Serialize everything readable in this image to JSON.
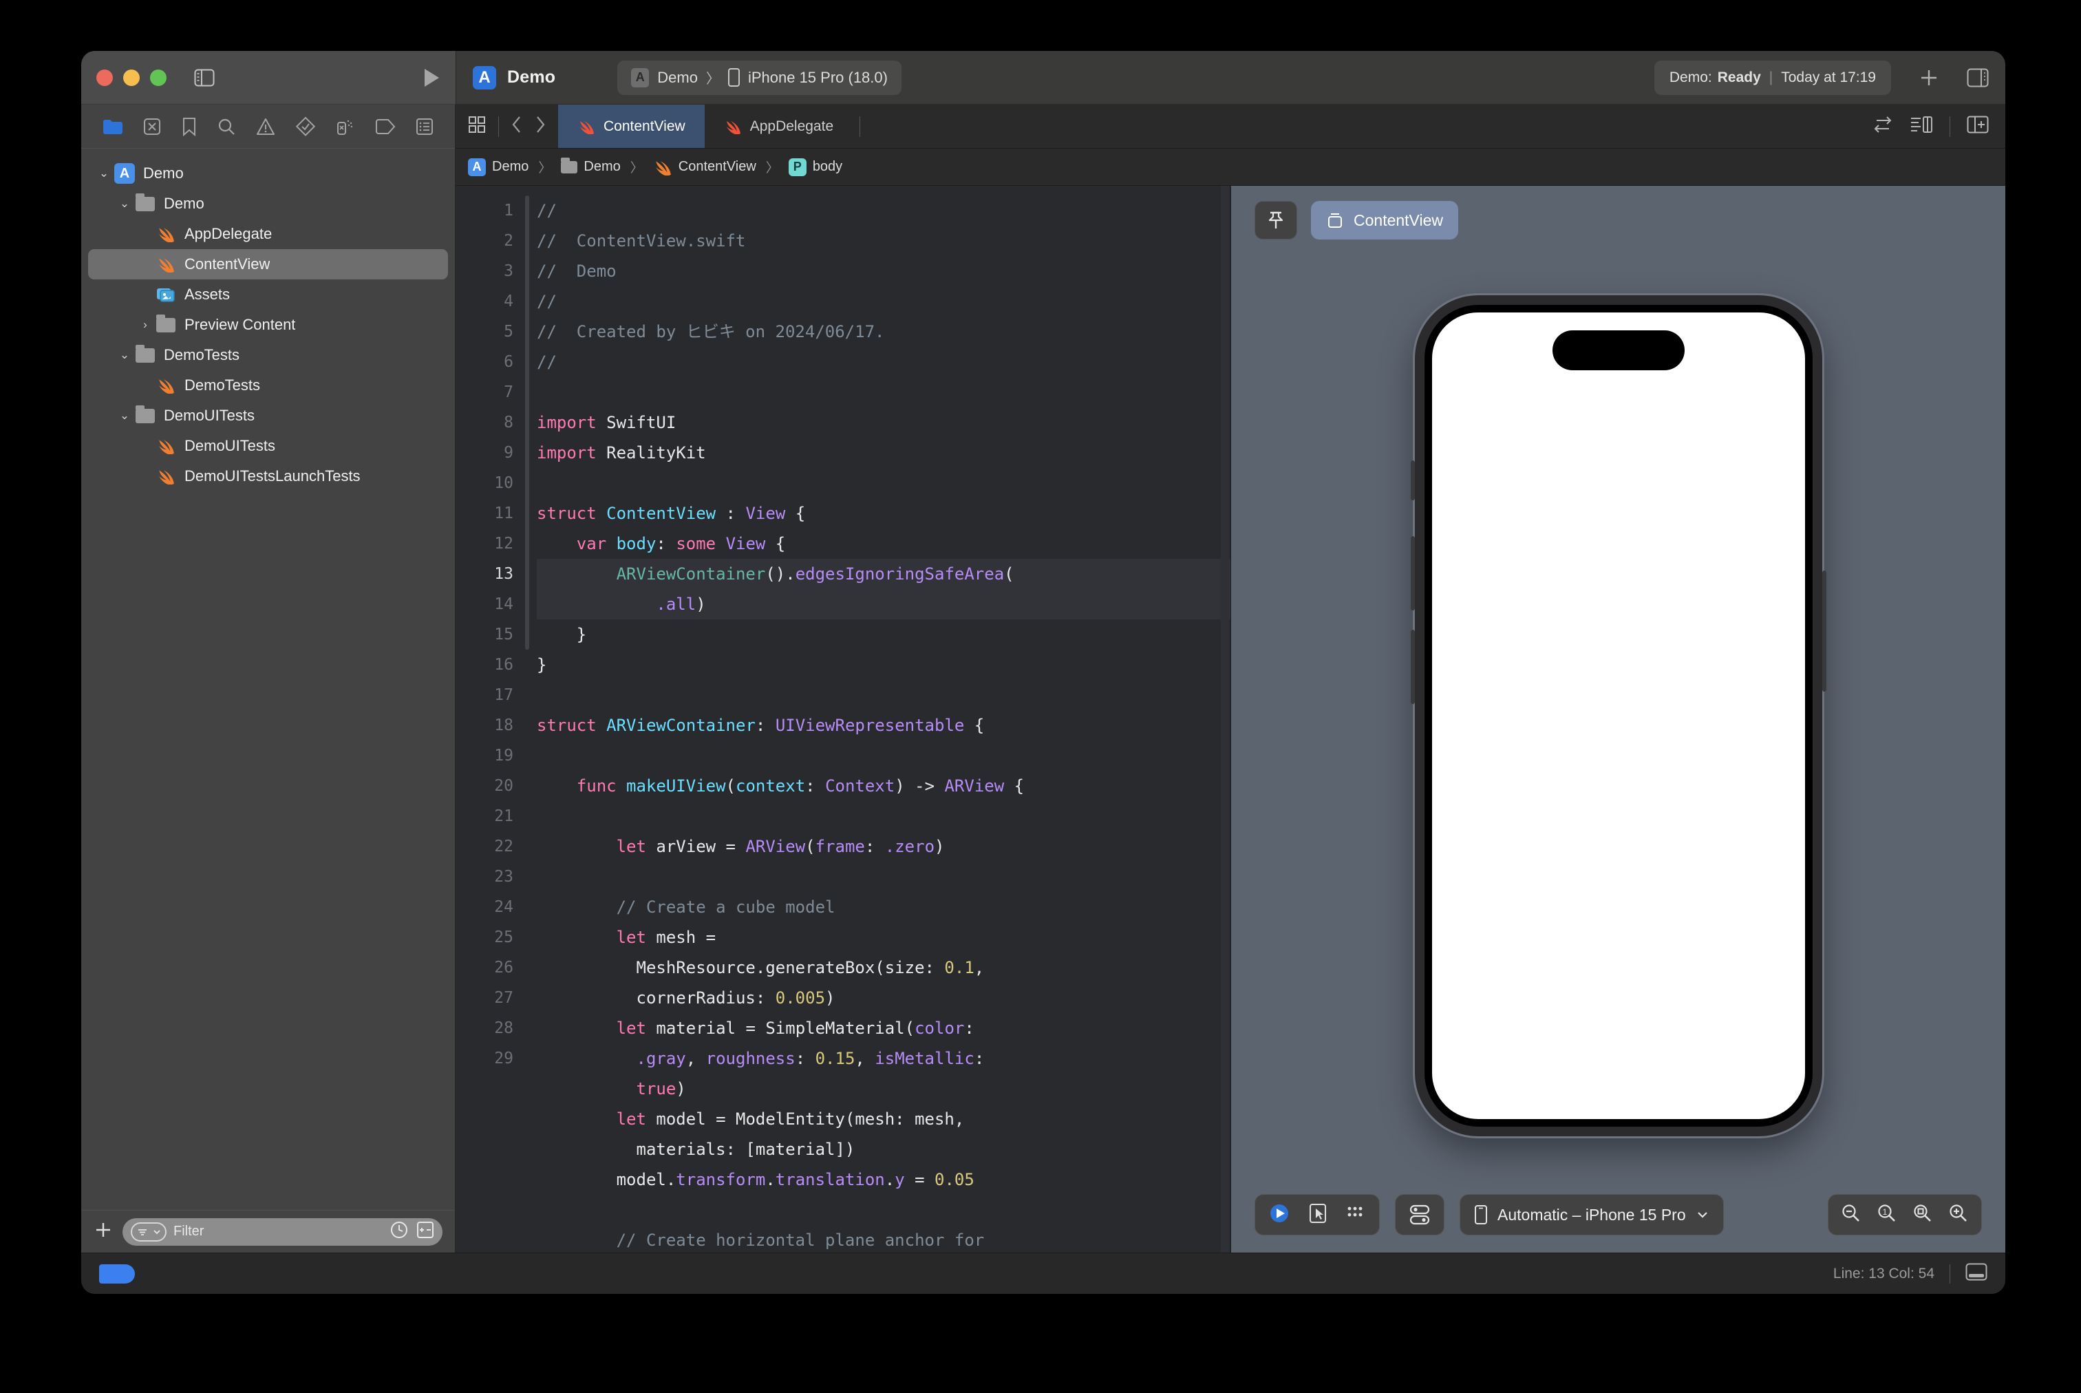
{
  "window": {
    "traffic_lights": [
      "close",
      "minimize",
      "zoom"
    ],
    "sidebar_toggle_icon": "sidebar-icon",
    "run_icon": "run-triangle-icon"
  },
  "toolbar": {
    "app_icon": "xcode-app-icon",
    "project_name": "Demo",
    "scheme": {
      "scheme_name": "Demo",
      "separator": "〉",
      "destination": "iPhone 15 Pro (18.0)",
      "scheme_icon": "app-target-icon",
      "device_icon": "iphone-icon"
    },
    "status": {
      "prefix": "Demo:",
      "state": "Ready",
      "separator": "|",
      "time": "Today at 17:19"
    },
    "add_label": "+",
    "inspector_toggle_icon": "inspector-panel-icon"
  },
  "navigator": {
    "tabs": [
      {
        "name": "project-navigator",
        "icon": "folder-icon",
        "active": true
      },
      {
        "name": "source-control-navigator",
        "icon": "source-control-icon",
        "active": false
      },
      {
        "name": "bookmark-navigator",
        "icon": "bookmark-icon",
        "active": false
      },
      {
        "name": "find-navigator",
        "icon": "search-icon",
        "active": false
      },
      {
        "name": "issue-navigator",
        "icon": "warning-triangle-icon",
        "active": false
      },
      {
        "name": "test-navigator",
        "icon": "diamond-check-icon",
        "active": false
      },
      {
        "name": "debug-navigator",
        "icon": "spray-can-icon",
        "active": false
      },
      {
        "name": "breakpoint-navigator",
        "icon": "tag-icon",
        "active": false
      },
      {
        "name": "report-navigator",
        "icon": "report-list-icon",
        "active": false
      }
    ],
    "tree": [
      {
        "label": "Demo",
        "indent": 0,
        "disclosure": "open",
        "icon": "xcode-project-icon",
        "selected": false
      },
      {
        "label": "Demo",
        "indent": 1,
        "disclosure": "open",
        "icon": "folder-icon",
        "selected": false
      },
      {
        "label": "AppDelegate",
        "indent": 2,
        "disclosure": "none",
        "icon": "swift-icon",
        "selected": false
      },
      {
        "label": "ContentView",
        "indent": 2,
        "disclosure": "none",
        "icon": "swift-icon",
        "selected": true
      },
      {
        "label": "Assets",
        "indent": 2,
        "disclosure": "none",
        "icon": "assets-icon",
        "selected": false
      },
      {
        "label": "Preview Content",
        "indent": 2,
        "disclosure": "closed",
        "icon": "folder-icon",
        "selected": false
      },
      {
        "label": "DemoTests",
        "indent": 1,
        "disclosure": "open",
        "icon": "folder-icon",
        "selected": false
      },
      {
        "label": "DemoTests",
        "indent": 2,
        "disclosure": "none",
        "icon": "swift-icon",
        "selected": false
      },
      {
        "label": "DemoUITests",
        "indent": 1,
        "disclosure": "open",
        "icon": "folder-icon",
        "selected": false
      },
      {
        "label": "DemoUITests",
        "indent": 2,
        "disclosure": "none",
        "icon": "swift-icon",
        "selected": false
      },
      {
        "label": "DemoUITestsLaunchTests",
        "indent": 2,
        "disclosure": "none",
        "icon": "swift-icon",
        "selected": false
      }
    ],
    "filter": {
      "add_label": "+",
      "placeholder": "Filter",
      "filter_dropdown_icon": "filter-dropdown-icon",
      "recent_icon": "clock-icon",
      "add_remove_icon": "plus-minus-icon"
    }
  },
  "editor": {
    "grid_icon": "editor-grid-icon",
    "back_icon": "chevron-left-icon",
    "forward_icon": "chevron-right-icon",
    "tabs": [
      {
        "label": "ContentView",
        "icon": "swift-icon",
        "active": true
      },
      {
        "label": "AppDelegate",
        "icon": "swift-icon",
        "active": false
      }
    ],
    "trailing_icons": [
      "swap-arrows-icon",
      "minimap-icon",
      "add-editor-icon"
    ],
    "breadcrumb": [
      {
        "label": "Demo",
        "icon": "xcode-project-icon"
      },
      {
        "label": "Demo",
        "icon": "folder-icon"
      },
      {
        "label": "ContentView",
        "icon": "swift-icon"
      },
      {
        "label": "body",
        "icon": "property-badge-icon"
      }
    ],
    "breadcrumb_separator": "〉",
    "highlighted_line": 13,
    "code_lines": [
      {
        "n": "1",
        "tokens": [
          {
            "t": "//",
            "c": "cmt"
          }
        ]
      },
      {
        "n": "2",
        "tokens": [
          {
            "t": "//  ContentView.swift",
            "c": "cmt"
          }
        ]
      },
      {
        "n": "3",
        "tokens": [
          {
            "t": "//  Demo",
            "c": "cmt"
          }
        ]
      },
      {
        "n": "4",
        "tokens": [
          {
            "t": "//",
            "c": "cmt"
          }
        ]
      },
      {
        "n": "5",
        "tokens": [
          {
            "t": "//  Created by ヒビキ on 2024/06/17.",
            "c": "cmt"
          }
        ]
      },
      {
        "n": "6",
        "tokens": [
          {
            "t": "//",
            "c": "cmt"
          }
        ]
      },
      {
        "n": "7",
        "tokens": []
      },
      {
        "n": "8",
        "tokens": [
          {
            "t": "import",
            "c": "kw"
          },
          {
            "t": " SwiftUI",
            "c": "plain"
          }
        ]
      },
      {
        "n": "9",
        "tokens": [
          {
            "t": "import",
            "c": "kw"
          },
          {
            "t": " RealityKit",
            "c": "plain"
          }
        ]
      },
      {
        "n": "10",
        "tokens": []
      },
      {
        "n": "11",
        "tokens": [
          {
            "t": "struct",
            "c": "kw"
          },
          {
            "t": " ",
            "c": "plain"
          },
          {
            "t": "ContentView",
            "c": "type"
          },
          {
            "t": " : ",
            "c": "plain"
          },
          {
            "t": "View",
            "c": "ptype"
          },
          {
            "t": " {",
            "c": "plain"
          }
        ]
      },
      {
        "n": "12",
        "tokens": [
          {
            "t": "    ",
            "c": "plain"
          },
          {
            "t": "var",
            "c": "kw"
          },
          {
            "t": " ",
            "c": "plain"
          },
          {
            "t": "body",
            "c": "type"
          },
          {
            "t": ": ",
            "c": "plain"
          },
          {
            "t": "some",
            "c": "kw"
          },
          {
            "t": " ",
            "c": "plain"
          },
          {
            "t": "View",
            "c": "ptype"
          },
          {
            "t": " {",
            "c": "plain"
          }
        ]
      },
      {
        "n": "13",
        "tokens": [
          {
            "t": "        ",
            "c": "plain"
          },
          {
            "t": "ARViewContainer",
            "c": "fn"
          },
          {
            "t": "()",
            "c": "plain"
          },
          {
            "t": ".",
            "c": "plain"
          },
          {
            "t": "edgesIgnoringSafeArea",
            "c": "ptype"
          },
          {
            "t": "(",
            "c": "plain"
          }
        ]
      },
      {
        "n": "",
        "tokens": [
          {
            "t": "            ",
            "c": "plain"
          },
          {
            "t": ".all",
            "c": "ptype"
          },
          {
            "t": ")",
            "c": "plain"
          }
        ]
      },
      {
        "n": "14",
        "tokens": [
          {
            "t": "    }",
            "c": "plain"
          }
        ]
      },
      {
        "n": "15",
        "tokens": [
          {
            "t": "}",
            "c": "plain"
          }
        ]
      },
      {
        "n": "16",
        "tokens": []
      },
      {
        "n": "17",
        "tokens": [
          {
            "t": "struct",
            "c": "kw"
          },
          {
            "t": " ",
            "c": "plain"
          },
          {
            "t": "ARViewContainer",
            "c": "type"
          },
          {
            "t": ": ",
            "c": "plain"
          },
          {
            "t": "UIViewRepresentable",
            "c": "ptype"
          },
          {
            "t": " {",
            "c": "plain"
          }
        ]
      },
      {
        "n": "18",
        "tokens": []
      },
      {
        "n": "19",
        "tokens": [
          {
            "t": "    ",
            "c": "plain"
          },
          {
            "t": "func",
            "c": "kw"
          },
          {
            "t": " ",
            "c": "plain"
          },
          {
            "t": "makeUIView",
            "c": "type"
          },
          {
            "t": "(",
            "c": "plain"
          },
          {
            "t": "context",
            "c": "type"
          },
          {
            "t": ": ",
            "c": "plain"
          },
          {
            "t": "Context",
            "c": "ptype"
          },
          {
            "t": ") -> ",
            "c": "plain"
          },
          {
            "t": "ARView",
            "c": "ptype"
          },
          {
            "t": " {",
            "c": "plain"
          }
        ]
      },
      {
        "n": "20",
        "tokens": []
      },
      {
        "n": "21",
        "tokens": [
          {
            "t": "        ",
            "c": "plain"
          },
          {
            "t": "let",
            "c": "kw"
          },
          {
            "t": " arView = ",
            "c": "plain"
          },
          {
            "t": "ARView",
            "c": "ptype"
          },
          {
            "t": "(",
            "c": "plain"
          },
          {
            "t": "frame",
            "c": "ptype"
          },
          {
            "t": ": ",
            "c": "plain"
          },
          {
            "t": ".zero",
            "c": "ptype"
          },
          {
            "t": ")",
            "c": "plain"
          }
        ]
      },
      {
        "n": "22",
        "tokens": []
      },
      {
        "n": "23",
        "tokens": [
          {
            "t": "        ",
            "c": "plain"
          },
          {
            "t": "// Create a cube model",
            "c": "cmt"
          }
        ]
      },
      {
        "n": "24",
        "tokens": [
          {
            "t": "        ",
            "c": "plain"
          },
          {
            "t": "let",
            "c": "kw"
          },
          {
            "t": " mesh =",
            "c": "plain"
          }
        ]
      },
      {
        "n": "",
        "tokens": [
          {
            "t": "          MeshResource.generateBox(size: ",
            "c": "plain"
          },
          {
            "t": "0.1",
            "c": "num"
          },
          {
            "t": ",",
            "c": "plain"
          }
        ]
      },
      {
        "n": "",
        "tokens": [
          {
            "t": "          cornerRadius: ",
            "c": "plain"
          },
          {
            "t": "0.005",
            "c": "num"
          },
          {
            "t": ")",
            "c": "plain"
          }
        ]
      },
      {
        "n": "25",
        "tokens": [
          {
            "t": "        ",
            "c": "plain"
          },
          {
            "t": "let",
            "c": "kw"
          },
          {
            "t": " material = SimpleMaterial(",
            "c": "plain"
          },
          {
            "t": "color",
            "c": "ptype"
          },
          {
            "t": ":",
            "c": "plain"
          }
        ]
      },
      {
        "n": "",
        "tokens": [
          {
            "t": "          ",
            "c": "plain"
          },
          {
            "t": ".gray",
            "c": "ptype"
          },
          {
            "t": ", ",
            "c": "plain"
          },
          {
            "t": "roughness",
            "c": "ptype"
          },
          {
            "t": ": ",
            "c": "plain"
          },
          {
            "t": "0.15",
            "c": "num"
          },
          {
            "t": ", ",
            "c": "plain"
          },
          {
            "t": "isMetallic",
            "c": "ptype"
          },
          {
            "t": ":",
            "c": "plain"
          }
        ]
      },
      {
        "n": "",
        "tokens": [
          {
            "t": "          ",
            "c": "plain"
          },
          {
            "t": "true",
            "c": "kw"
          },
          {
            "t": ")",
            "c": "plain"
          }
        ]
      },
      {
        "n": "26",
        "tokens": [
          {
            "t": "        ",
            "c": "plain"
          },
          {
            "t": "let",
            "c": "kw"
          },
          {
            "t": " model = ModelEntity(mesh: mesh,",
            "c": "plain"
          }
        ]
      },
      {
        "n": "",
        "tokens": [
          {
            "t": "          materials: [material])",
            "c": "plain"
          }
        ]
      },
      {
        "n": "27",
        "tokens": [
          {
            "t": "        model.",
            "c": "plain"
          },
          {
            "t": "transform",
            "c": "ptype"
          },
          {
            "t": ".",
            "c": "plain"
          },
          {
            "t": "translation",
            "c": "ptype"
          },
          {
            "t": ".",
            "c": "plain"
          },
          {
            "t": "y",
            "c": "ptype"
          },
          {
            "t": " = ",
            "c": "plain"
          },
          {
            "t": "0.05",
            "c": "num"
          }
        ]
      },
      {
        "n": "28",
        "tokens": []
      },
      {
        "n": "29",
        "tokens": [
          {
            "t": "        ",
            "c": "plain"
          },
          {
            "t": "// Create horizontal plane anchor for",
            "c": "cmt"
          }
        ]
      }
    ]
  },
  "canvas": {
    "pin_icon": "pin-icon",
    "preview_label": "ContentView",
    "preview_icon": "preview-cube-icon",
    "device_frame": "iphone-15-pro",
    "controls": {
      "play_icon": "play-preview-icon",
      "select_icon": "pointer-select-icon",
      "variants_icon": "variants-grid-icon",
      "device_settings_icon": "device-settings-icon",
      "device_label": "Automatic – iPhone 15 Pro",
      "dropdown_icon": "chevron-down-icon"
    },
    "zoom_controls": [
      {
        "name": "zoom-out-button",
        "glyph": "−"
      },
      {
        "name": "zoom-actual-size-button",
        "glyph": "1"
      },
      {
        "name": "zoom-to-fit-button",
        "glyph": "□"
      },
      {
        "name": "zoom-in-button",
        "glyph": "+"
      }
    ]
  },
  "statusbar": {
    "left_tag_icon": "blue-tag-icon",
    "line_col": "Line: 13  Col: 54",
    "layout_icon": "debug-area-toggle-icon"
  },
  "colors": {
    "accent_blue": "#3b7ff0",
    "tab_active": "#3c506f",
    "canvas_bg": "#5c6470",
    "editor_bg": "#292a2e"
  }
}
